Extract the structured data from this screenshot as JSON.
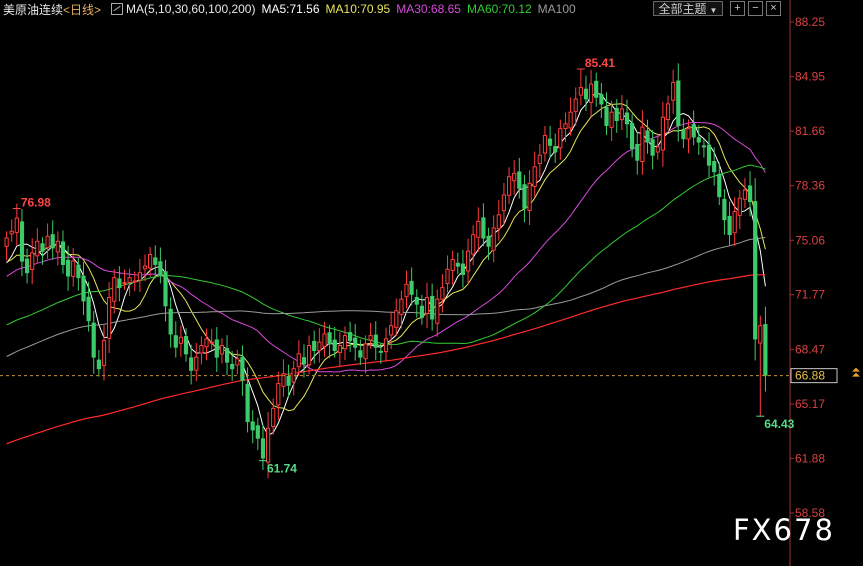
{
  "header": {
    "title": "美原油连续",
    "period": "<日线>",
    "ma_params": "MA(5,10,30,60,100,200)",
    "ma_values": [
      {
        "label": "MA5:71.56",
        "color": "#ffffff"
      },
      {
        "label": "MA10:70.95",
        "color": "#e6e65a"
      },
      {
        "label": "MA30:68.65",
        "color": "#d94adb"
      },
      {
        "label": "MA60:70.12",
        "color": "#33cc33"
      },
      {
        "label": "MA100",
        "color": "#9a9a9a"
      }
    ],
    "theme_button": "全部主题",
    "icons": [
      "plus-box-icon",
      "minus-box-icon",
      "close-box-icon"
    ]
  },
  "watermark": "FX678",
  "chart_data": {
    "type": "candlestick",
    "y_ticks": [
      "88.25",
      "84.95",
      "81.66",
      "78.36",
      "75.06",
      "71.77",
      "68.47",
      "65.17",
      "61.88",
      "58.58"
    ],
    "y_tick_values": [
      88.25,
      84.95,
      81.66,
      78.36,
      75.06,
      71.77,
      68.47,
      65.17,
      61.88,
      58.58
    ],
    "ylim": [
      57.0,
      89.0
    ],
    "current_price": 66.88,
    "current_price_label": "66.88",
    "annotations": [
      {
        "text": "76.98",
        "index": 2,
        "value": 76.98,
        "color": "#ff4444"
      },
      {
        "text": "61.74",
        "index": 50,
        "value": 61.74,
        "color": "#55dd88"
      },
      {
        "text": "85.41",
        "index": 112,
        "value": 85.41,
        "color": "#ff4444"
      },
      {
        "text": "64.43",
        "index": 147,
        "value": 64.43,
        "color": "#55dd88"
      }
    ],
    "closes": [
      75.2,
      75.6,
      76.4,
      73.8,
      73.1,
      74.3,
      75.0,
      74.4,
      75.3,
      74.6,
      75.0,
      73.6,
      72.9,
      73.8,
      72.8,
      71.4,
      70.2,
      68.0,
      67.3,
      69.0,
      71.6,
      72.8,
      72.2,
      72.5,
      72.8,
      72.6,
      73.1,
      73.5,
      74.2,
      73.6,
      73.0,
      71.1,
      69.4,
      68.6,
      69.2,
      68.2,
      67.2,
      68.0,
      68.7,
      69.1,
      68.9,
      68.0,
      68.7,
      67.7,
      67.3,
      67.9,
      66.6,
      64.1,
      63.6,
      63.1,
      61.9,
      63.7,
      64.9,
      66.4,
      67.0,
      66.3,
      67.3,
      68.2,
      67.6,
      68.7,
      68.4,
      68.9,
      69.4,
      68.8,
      68.4,
      68.7,
      69.3,
      69.0,
      68.6,
      68.0,
      68.8,
      69.3,
      68.6,
      68.3,
      69.1,
      69.9,
      70.8,
      71.5,
      72.4,
      71.8,
      71.2,
      70.4,
      71.6,
      70.3,
      71.5,
      72.2,
      73.3,
      73.9,
      73.5,
      73.0,
      74.4,
      75.4,
      76.2,
      75.2,
      74.7,
      75.8,
      76.6,
      77.8,
      78.9,
      79.1,
      78.2,
      77.0,
      78.5,
      79.5,
      80.2,
      81.4,
      80.8,
      80.4,
      81.8,
      82.1,
      82.8,
      83.6,
      84.3,
      83.6,
      84.5,
      83.7,
      83.3,
      82.0,
      82.8,
      82.3,
      83.0,
      82.1,
      80.6,
      79.9,
      81.9,
      81.0,
      80.2,
      80.7,
      82.5,
      83.3,
      84.6,
      82.0,
      81.2,
      81.8,
      81.3,
      81.0,
      80.7,
      79.6,
      79.2,
      77.7,
      76.3,
      75.4,
      76.8,
      77.6,
      78.1,
      77.4,
      69.1,
      69.9,
      66.9
    ],
    "ma_lines": [
      {
        "name": "MA5",
        "color": "#ffffff"
      },
      {
        "name": "MA10",
        "color": "#e6e65a"
      },
      {
        "name": "MA30",
        "color": "#d94adb"
      },
      {
        "name": "MA60",
        "color": "#33cc33"
      },
      {
        "name": "MA100",
        "color": "#9a9a9a"
      },
      {
        "name": "MA200",
        "color": "#ff2a2a"
      }
    ],
    "colors": {
      "up": "#ff3b3b",
      "down": "#3ccb6a",
      "axis": "#a03030",
      "dash": "#c89030"
    }
  }
}
